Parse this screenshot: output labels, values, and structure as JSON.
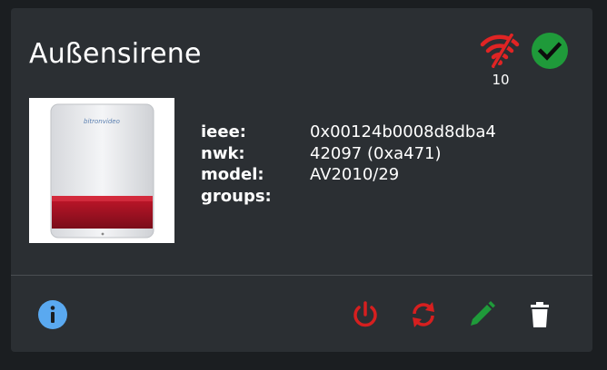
{
  "device": {
    "name": "Außensirene",
    "link_quality": "10",
    "fields": [
      {
        "label": "ieee:",
        "value": "0x00124b0008d8dba4"
      },
      {
        "label": "nwk:",
        "value": "42097 (0xa471)"
      },
      {
        "label": "model:",
        "value": "AV2010/29"
      },
      {
        "label": "groups:",
        "value": ""
      }
    ],
    "image_brand_text": "bitronvideo"
  },
  "icons": {
    "signal": "wifi-signal-icon",
    "status": "check-circle-icon",
    "info": "info-icon",
    "power": "power-icon",
    "refresh": "refresh-icon",
    "edit": "pencil-icon",
    "delete": "trash-icon"
  },
  "colors": {
    "background": "#1b1e21",
    "card": "#2b2f33",
    "signal": "#e02424",
    "ok_green": "#1f9a3a",
    "info_blue": "#5aa9f0",
    "power_red": "#d61f1f",
    "edit_green": "#1f9a3a",
    "delete_white": "#ffffff"
  }
}
